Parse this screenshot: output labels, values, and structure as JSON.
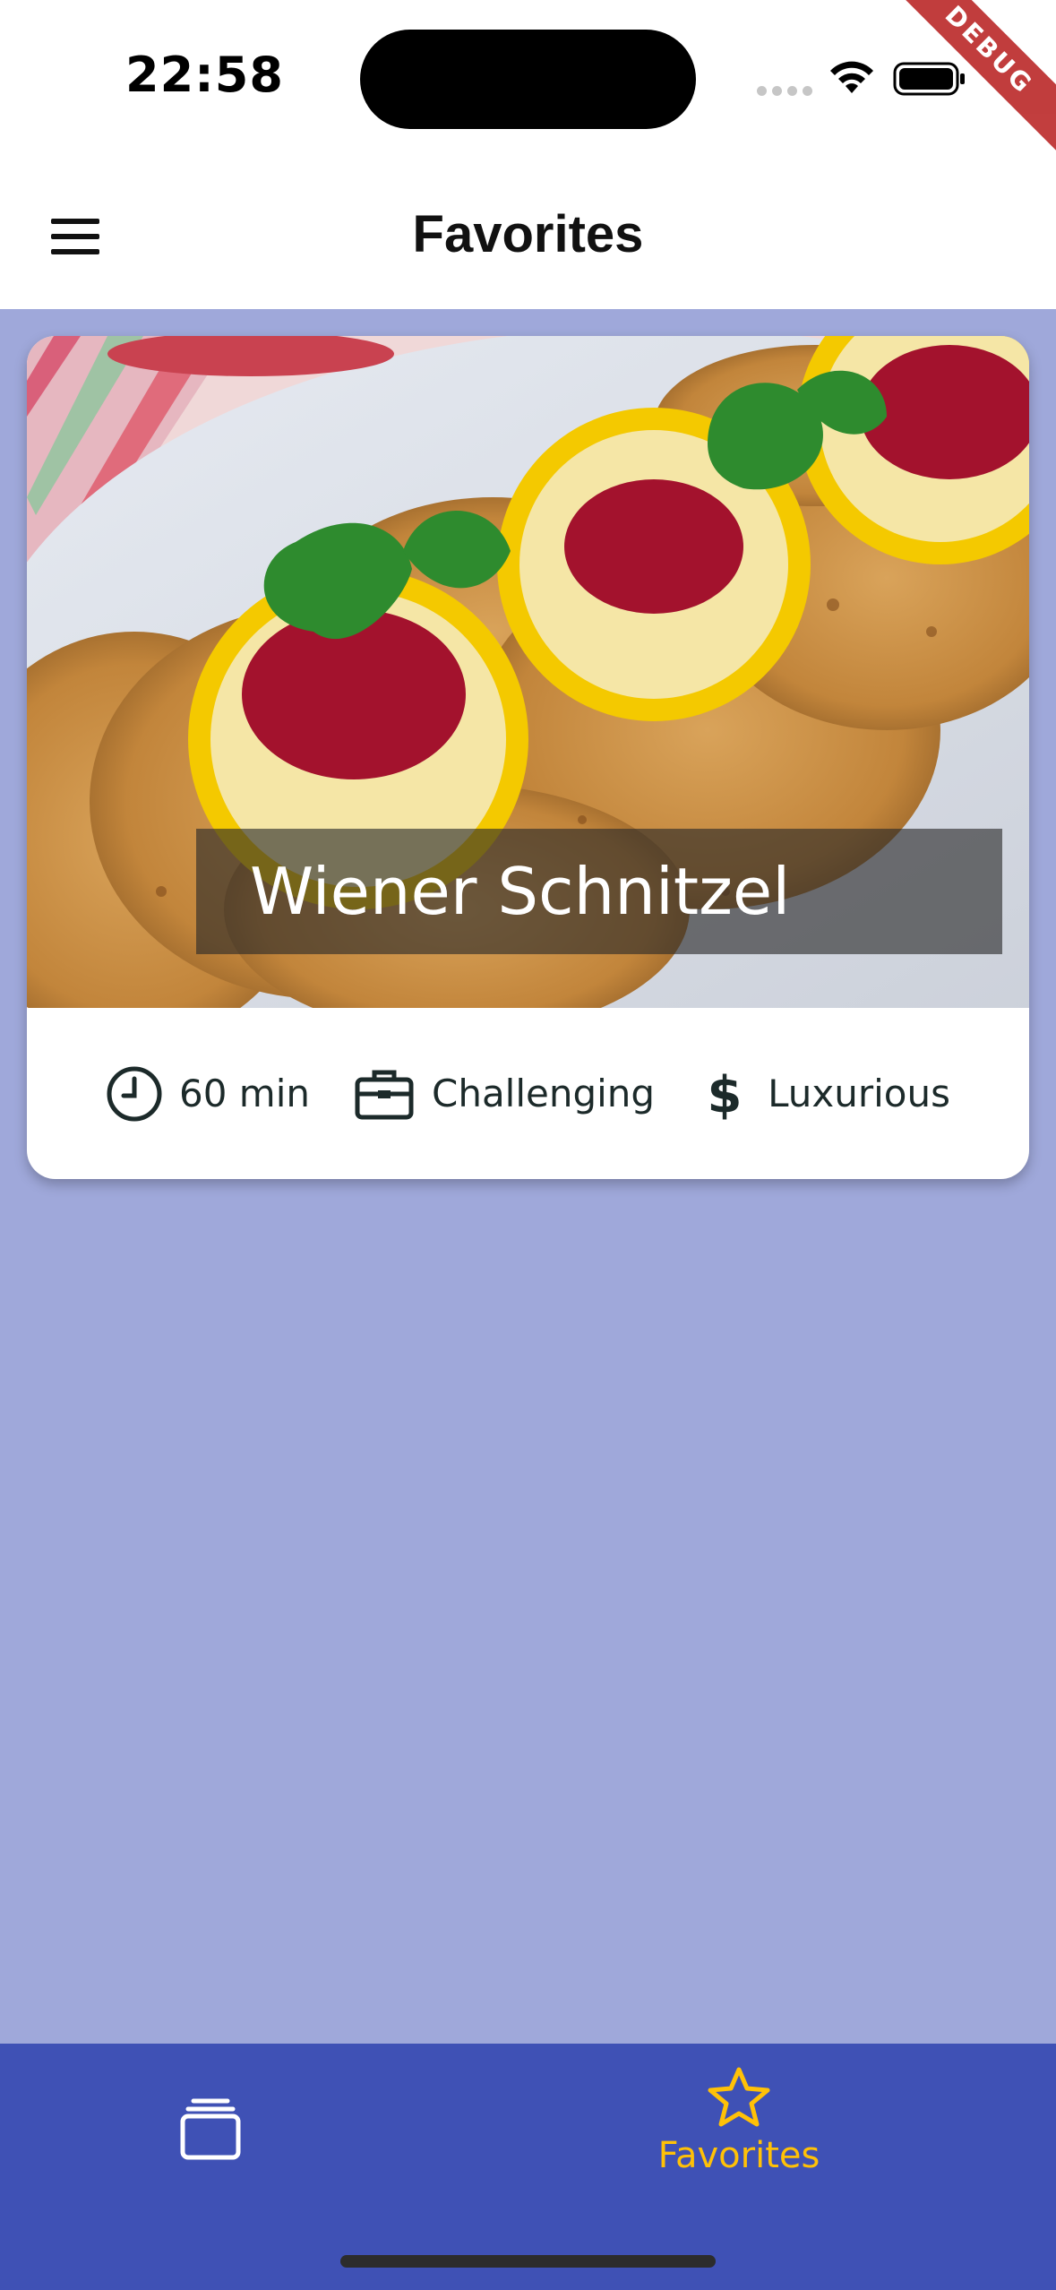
{
  "status_bar": {
    "time": "22:58",
    "debug_label": "DEBUG"
  },
  "app_bar": {
    "title": "Favorites",
    "menu_icon": "hamburger-menu-icon"
  },
  "meal": {
    "title": "Wiener Schnitzel",
    "duration": "60 min",
    "complexity": "Challenging",
    "affordability": "Luxurious",
    "icons": {
      "duration": "clock-icon",
      "complexity": "briefcase-icon",
      "affordability": "dollar-icon"
    }
  },
  "bottom_nav": {
    "items": [
      {
        "label": "",
        "icon": "categories-icon",
        "active": false
      },
      {
        "label": "Favorites",
        "icon": "star-icon",
        "active": true
      }
    ],
    "active_color": "#ffc107"
  },
  "colors": {
    "background": "#9fa8da",
    "nav": "#3f51b5",
    "accent": "#ffc107"
  }
}
